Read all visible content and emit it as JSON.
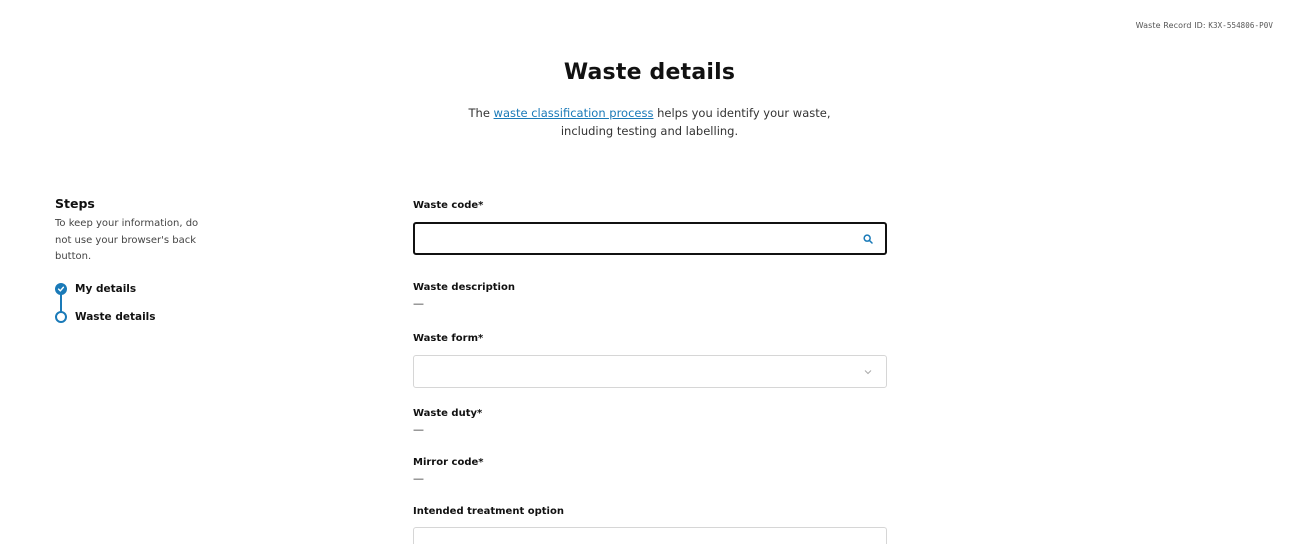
{
  "header": {
    "record_id_label": "Waste Record ID:",
    "record_id_value": "K3X-554806-P0V"
  },
  "page": {
    "title": "Waste details",
    "intro_prefix": "The ",
    "intro_link": "waste classification process",
    "intro_suffix_line1": " helps you identify your waste,",
    "intro_line2": "including testing and labelling."
  },
  "steps": {
    "heading": "Steps",
    "note": "To keep your information, do not use your browser's back button.",
    "items": [
      {
        "label": "My details",
        "status": "complete"
      },
      {
        "label": "Waste details",
        "status": "current"
      }
    ]
  },
  "form": {
    "waste_code": {
      "label": "Waste code*",
      "value": "",
      "icon": "search-icon"
    },
    "waste_description": {
      "label": "Waste description",
      "value": "—"
    },
    "waste_form": {
      "label": "Waste form*",
      "selected": "",
      "icon": "chevron-down-icon"
    },
    "waste_duty": {
      "label": "Waste duty*",
      "value": "—"
    },
    "mirror_code": {
      "label": "Mirror code*",
      "value": "—"
    },
    "intended_treatment": {
      "label": "Intended treatment option"
    }
  },
  "colors": {
    "accent": "#1a7ab8",
    "text": "#111111",
    "border": "#d6d6d6"
  }
}
